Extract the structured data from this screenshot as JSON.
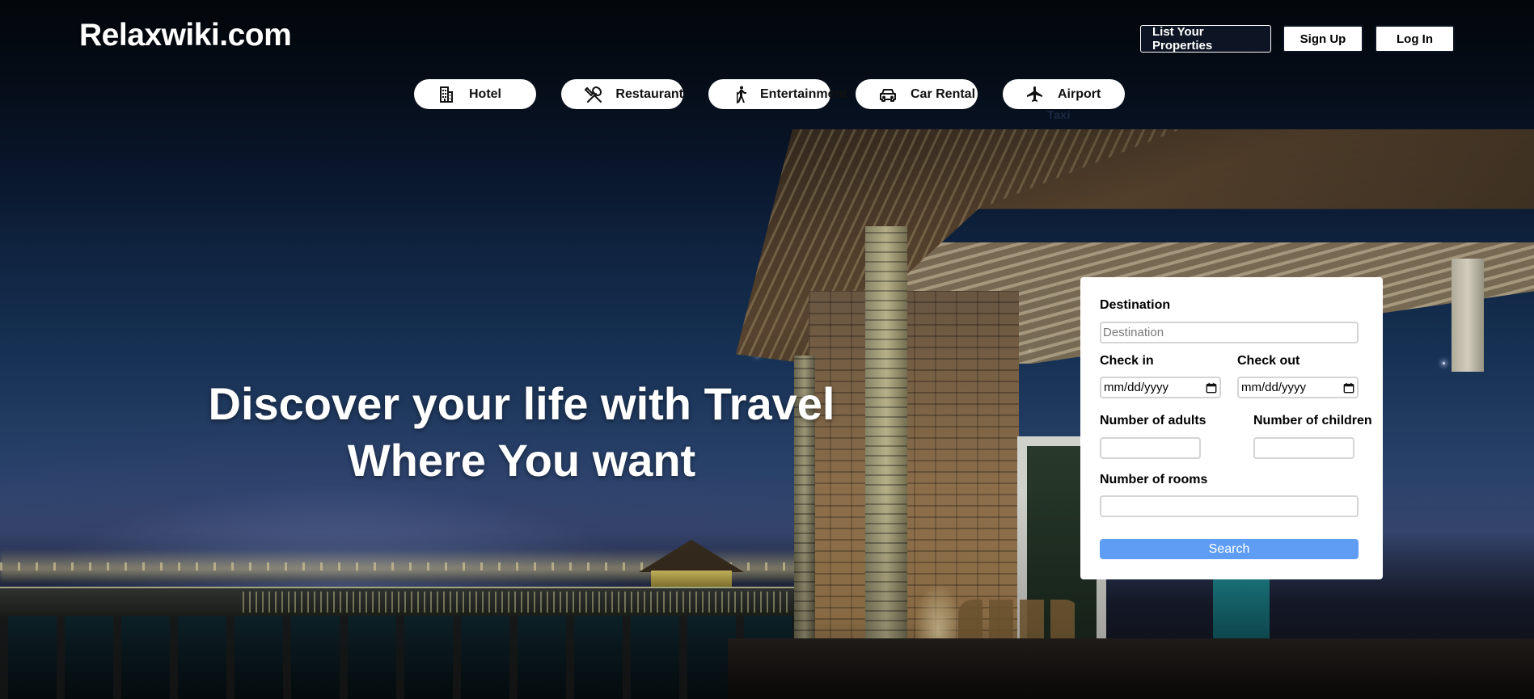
{
  "header": {
    "logo": "Relaxwiki.com",
    "list_properties_label": "List Your Properties",
    "signup_label": "Sign Up",
    "login_label": "Log In"
  },
  "nav": {
    "items": [
      {
        "label": "Hotel",
        "icon": "building-icon"
      },
      {
        "label": "Restaurant",
        "icon": "utensils-icon"
      },
      {
        "label": "Entertainment",
        "icon": "hiker-icon"
      },
      {
        "label": "Car Rental",
        "icon": "car-icon"
      },
      {
        "label": "Airport",
        "sublabel": "Taxi",
        "icon": "plane-icon"
      }
    ]
  },
  "hero": {
    "line1": "Discover your life with Travel",
    "line2": "Where You want"
  },
  "search_form": {
    "destination_label": "Destination",
    "destination_placeholder": "Destination",
    "destination_value": "",
    "checkin_label": "Check in",
    "checkin_placeholder": "mm/dd/yyyy",
    "checkout_label": "Check out",
    "checkout_placeholder": "mm/dd/yyyy",
    "adults_label": "Number of adults",
    "adults_value": "",
    "children_label": "Number of children",
    "children_value": "",
    "rooms_label": "Number of rooms",
    "rooms_value": "",
    "search_label": "Search"
  },
  "colors": {
    "search_button": "#5f9df5",
    "header_button_dark": "#0d1524",
    "panel_background": "#ffffff"
  }
}
